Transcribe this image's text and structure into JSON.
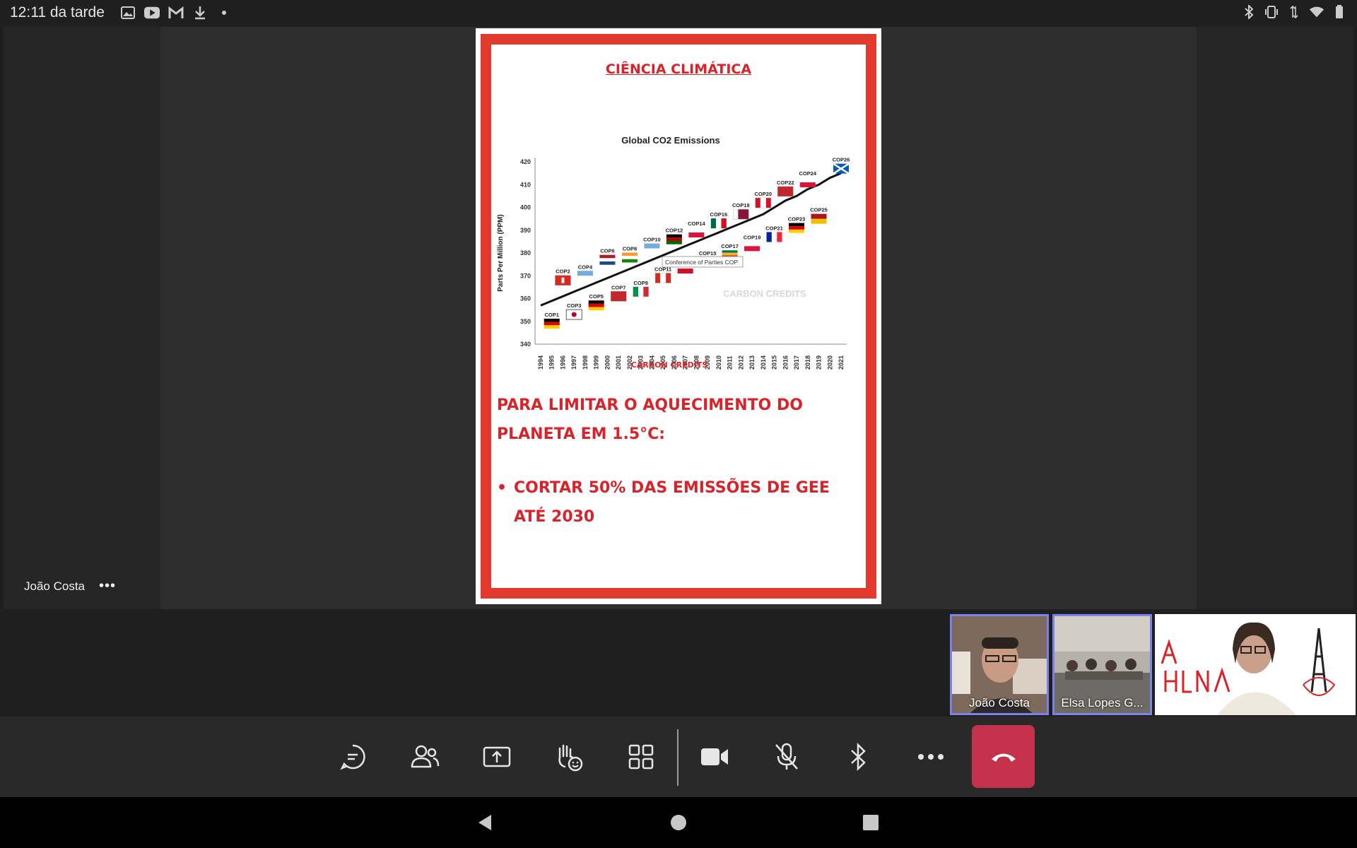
{
  "status_bar": {
    "time": "12:11 da tarde"
  },
  "presenter": {
    "name": "João Costa",
    "more": "•••"
  },
  "slide": {
    "title": "CIÊNCIA CLIMÁTICA",
    "goal_text": "PARA LIMITAR O AQUECIMENTO DO PLANETA EM 1.5°C:",
    "bullet": "CORTAR 50% DAS EMISSÕES DE GEE ATÉ 2030"
  },
  "chart_data": {
    "type": "line",
    "title": "Global CO2 Emissions",
    "ylabel": "Parts Per Million (PPM)",
    "ylim": [
      340,
      420
    ],
    "yticks": [
      "340",
      "350",
      "360",
      "370",
      "380",
      "390",
      "400",
      "410",
      "420"
    ],
    "x": [
      "1994",
      "1995",
      "1996",
      "1997",
      "1998",
      "1999",
      "2000",
      "2001",
      "2002",
      "2003",
      "2004",
      "2005",
      "2006",
      "2007",
      "2008",
      "2009",
      "2010",
      "2011",
      "2012",
      "2013",
      "2014",
      "2015",
      "2016",
      "2017",
      "2018",
      "2019",
      "2020",
      "2021"
    ],
    "series": [
      {
        "values": [
          357,
          359,
          361,
          363,
          365,
          367,
          369,
          371,
          373,
          375,
          377,
          379,
          381,
          383,
          385,
          387,
          389,
          391,
          393,
          395,
          397,
          400,
          403,
          405,
          408,
          410,
          413,
          415
        ]
      }
    ],
    "annotations": [
      {
        "label": "COP1",
        "year": "1995",
        "value": 349,
        "flag": "germany",
        "colors": [
          "#000000",
          "#dd0000",
          "#ffce00"
        ]
      },
      {
        "label": "COP2",
        "year": "1996",
        "value": 368,
        "flag": "switzerland",
        "colors": [
          "#da291c",
          "#ffffff"
        ]
      },
      {
        "label": "COP3",
        "year": "1997",
        "value": 353,
        "flag": "japan",
        "colors": [
          "#ffffff",
          "#bc002d"
        ]
      },
      {
        "label": "COP4",
        "year": "1998",
        "value": 370,
        "flag": "argentina",
        "colors": [
          "#74acdf",
          "#ffffff"
        ]
      },
      {
        "label": "COP5",
        "year": "1999",
        "value": 357,
        "flag": "germany",
        "colors": [
          "#000000",
          "#dd0000",
          "#ffce00"
        ]
      },
      {
        "label": "COP6",
        "year": "2000",
        "value": 377,
        "flag": "netherlands",
        "colors": [
          "#ae1c28",
          "#ffffff",
          "#21468b"
        ]
      },
      {
        "label": "COP7",
        "year": "2001",
        "value": 361,
        "flag": "morocco",
        "colors": [
          "#c1272d",
          "#006233"
        ]
      },
      {
        "label": "COP8",
        "year": "2002",
        "value": 378,
        "flag": "india",
        "colors": [
          "#ff9933",
          "#ffffff",
          "#138808"
        ]
      },
      {
        "label": "COP9",
        "year": "2003",
        "value": 363,
        "flag": "italy",
        "colors": [
          "#009246",
          "#ffffff",
          "#ce2b37"
        ]
      },
      {
        "label": "COP10",
        "year": "2004",
        "value": 382,
        "flag": "argentina",
        "colors": [
          "#74acdf",
          "#ffffff"
        ]
      },
      {
        "label": "COP11",
        "year": "2005",
        "value": 369,
        "flag": "canada",
        "colors": [
          "#d52b1e",
          "#ffffff"
        ]
      },
      {
        "label": "COP12",
        "year": "2006",
        "value": 386,
        "flag": "kenya",
        "colors": [
          "#000000",
          "#bb0000",
          "#006600"
        ]
      },
      {
        "label": "COP13",
        "year": "2007",
        "value": 371,
        "flag": "indonesia",
        "colors": [
          "#ce1126",
          "#ffffff"
        ]
      },
      {
        "label": "COP14",
        "year": "2008",
        "value": 389,
        "flag": "poland",
        "colors": [
          "#ffffff",
          "#dc143c"
        ]
      },
      {
        "label": "COP15",
        "year": "2009",
        "value": 376,
        "flag": "denmark",
        "colors": [
          "#c60c30",
          "#ffffff"
        ]
      },
      {
        "label": "COP16",
        "year": "2010",
        "value": 393,
        "flag": "mexico",
        "colors": [
          "#006847",
          "#ffffff",
          "#ce1126"
        ]
      },
      {
        "label": "COP17",
        "year": "2011",
        "value": 379,
        "flag": "south-africa",
        "colors": [
          "#007a4d",
          "#ffb612",
          "#de3831",
          "#002395"
        ]
      },
      {
        "label": "COP18",
        "year": "2012",
        "value": 397,
        "flag": "qatar",
        "colors": [
          "#8a1538",
          "#ffffff"
        ]
      },
      {
        "label": "COP19",
        "year": "2013",
        "value": 383,
        "flag": "poland",
        "colors": [
          "#ffffff",
          "#dc143c"
        ]
      },
      {
        "label": "COP20",
        "year": "2014",
        "value": 402,
        "flag": "peru",
        "colors": [
          "#d91023",
          "#ffffff"
        ]
      },
      {
        "label": "COP21",
        "year": "2015",
        "value": 387,
        "flag": "france",
        "colors": [
          "#002395",
          "#ffffff",
          "#ed2939"
        ]
      },
      {
        "label": "COP22",
        "year": "2016",
        "value": 407,
        "flag": "morocco",
        "colors": [
          "#c1272d",
          "#006233"
        ]
      },
      {
        "label": "COP23",
        "year": "2017",
        "value": 391,
        "flag": "germany",
        "colors": [
          "#000000",
          "#dd0000",
          "#ffce00"
        ]
      },
      {
        "label": "COP24",
        "year": "2018",
        "value": 411,
        "flag": "poland",
        "colors": [
          "#ffffff",
          "#dc143c"
        ]
      },
      {
        "label": "COP25",
        "year": "2019",
        "value": 395,
        "flag": "spain",
        "colors": [
          "#aa151b",
          "#f1bf00"
        ]
      },
      {
        "label": "COP26",
        "year": "2021",
        "value": 417,
        "flag": "scotland",
        "colors": [
          "#005eb8",
          "#ffffff"
        ]
      }
    ],
    "tooltip": "Conference of Parties COP",
    "watermark": "CARBON CREDITS",
    "source": "CARBON CREDITS"
  },
  "participants": [
    {
      "name": "João Costa"
    },
    {
      "name": "Elsa Lopes G..."
    },
    {
      "name": ""
    }
  ],
  "toolbar": {
    "items": [
      "chat-icon",
      "people-icon",
      "share-screen-icon",
      "raise-hand-icon",
      "view-grid-icon",
      "camera-icon",
      "mic-off-icon",
      "bluetooth-icon",
      "more-icon"
    ],
    "hangup_color": "#c4314b",
    "accent": "#7b83eb"
  }
}
